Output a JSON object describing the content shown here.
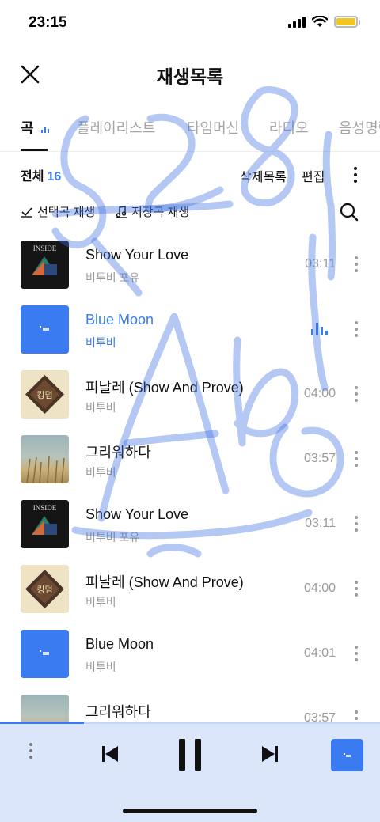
{
  "status_bar": {
    "time": "23:15"
  },
  "header": {
    "title": "재생목록"
  },
  "tabs": [
    {
      "label": "곡",
      "active": true
    },
    {
      "label": "플레이리스트",
      "active": false
    },
    {
      "label": "타임머신",
      "active": false
    },
    {
      "label": "라디오",
      "active": false
    },
    {
      "label": "음성명령",
      "active": false
    }
  ],
  "list_header": {
    "total_label": "전체",
    "total_count": "16",
    "deleted_list_label": "삭제목록",
    "edit_label": "편집"
  },
  "actions": {
    "play_selected": "선택곡 재생",
    "play_saved": "저장곡 재생"
  },
  "tracks": [
    {
      "title": "Show Your Love",
      "artist": "비투비 포유",
      "duration": "03:11",
      "cover": "inside",
      "cover_text": "INSIDE"
    },
    {
      "title": "Blue Moon",
      "artist": "비투비",
      "duration": "",
      "cover": "blue",
      "playing": true
    },
    {
      "title": "피날레 (Show And Prove)",
      "artist": "비투비",
      "duration": "04:00",
      "cover": "kingdom",
      "cover_text": "킹덤"
    },
    {
      "title": "그리워하다",
      "artist": "비투비",
      "duration": "03:57",
      "cover": "field"
    },
    {
      "title": "Show Your Love",
      "artist": "비투비 포유",
      "duration": "03:11",
      "cover": "inside",
      "cover_text": "INSIDE"
    },
    {
      "title": "피날레 (Show And Prove)",
      "artist": "비투비",
      "duration": "04:00",
      "cover": "kingdom",
      "cover_text": "킹덤"
    },
    {
      "title": "Blue Moon",
      "artist": "비투비",
      "duration": "04:01",
      "cover": "blue"
    },
    {
      "title": "그리워하다",
      "artist": "",
      "duration": "03:57",
      "cover": "field"
    }
  ],
  "player": {
    "progress": 0.22
  },
  "colors": {
    "accent": "#3a7bf1",
    "player_bg": "#dbe6fa",
    "scribble": "#3a6fe0"
  }
}
